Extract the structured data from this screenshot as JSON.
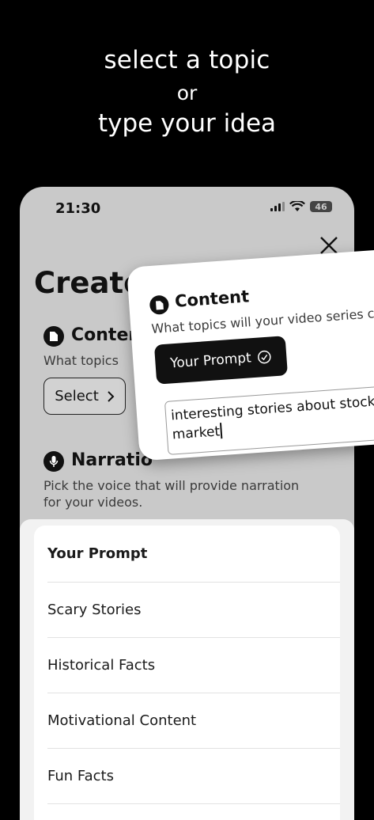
{
  "headline": {
    "line1": "select a topic",
    "line2": "or",
    "line3": "type your idea"
  },
  "status_bar": {
    "time": "21:30",
    "battery": "46",
    "icons": [
      "signal-icon",
      "wifi-icon",
      "battery-icon"
    ]
  },
  "screen": {
    "title": "Create ",
    "content_section": {
      "title": "Conten",
      "subtitle": "What topics",
      "select_label": "Select"
    },
    "narration_section": {
      "title": "Narratio",
      "subtitle_line1": "Pick the voice that will provide narration",
      "subtitle_line2": "for your videos."
    }
  },
  "popup": {
    "title": "Content",
    "subtitle": "What topics will your video series co",
    "pill_label": "Your Prompt",
    "input_line1": "interesting stories about stock",
    "input_line2": "market"
  },
  "topic_sheet": {
    "options": [
      "Your Prompt",
      "Scary Stories",
      "Historical Facts",
      "Motivational Content",
      "Fun Facts"
    ]
  },
  "colors": {
    "background": "#000000",
    "phone_bg": "#c9c9c9",
    "accent": "#111111",
    "sheet_bg": "#ffffff"
  }
}
